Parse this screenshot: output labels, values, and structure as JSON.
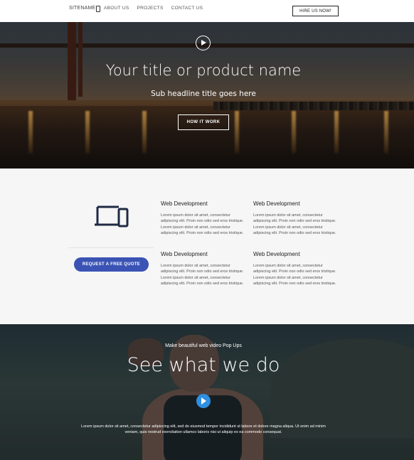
{
  "nav": {
    "sitename": "SITENAME",
    "links": [
      "ABOUT US",
      "PROJECTS",
      "CONTACT US"
    ],
    "cta": "HIRE US NOW!"
  },
  "hero": {
    "title": "Your title or product name",
    "subtitle": "Sub headline title goes here",
    "button": "HOW IT WORK",
    "play_icon": "play-circle-icon"
  },
  "services": {
    "icon": "devices-icon",
    "quote_button": "REQUEST A FREE QUOTE",
    "items": [
      {
        "title": "Web Development",
        "text": "Lorem ipsum dolor sit amet, consectetur adipiscing elit. Proin non odio sed eros tristique. Lorem ipsum dolor sit amet, consectetur adipiscing elit. Proin non odio sed eros tristique."
      },
      {
        "title": "Web Development",
        "text": "Lorem ipsum dolor sit amet, consectetur adipiscing elit. Proin non odio sed eros tristique. Lorem ipsum dolor sit amet, consectetur adipiscing elit. Proin non odio sed eros tristique."
      },
      {
        "title": "Web Development",
        "text": "Lorem ipsum dolor sit amet, consectetur adipiscing elit. Proin non odio sed eros tristique. Lorem ipsum dolor sit amet, consectetur adipiscing elit. Proin non odio sed eros tristique."
      },
      {
        "title": "Web Development",
        "text": "Lorem ipsum dolor sit amet, consectetur adipiscing elit. Proin non odio sed eros tristique. Lorem ipsum dolor sit amet, consectetur adipiscing elit. Proin non odio sed eros tristique."
      }
    ]
  },
  "video": {
    "kicker": "Make beautiful web video Pop Ups",
    "title": "See what we do",
    "text": "Lorem ipsum dolor sit amet, consectetur adipiscing elit, sed do eiusmod tempor incididunt ut labore et dolore magna aliqua. Ut enim ad minim veniam, quis nostrud exercitation ullamco laboris nisi ut aliquip ex ea commodo consequat.",
    "play_icon": "play-button-icon",
    "accent": "#2f8fe0"
  },
  "colors": {
    "quote_button": "#3a53b4",
    "services_bg": "#f6f6f6"
  }
}
